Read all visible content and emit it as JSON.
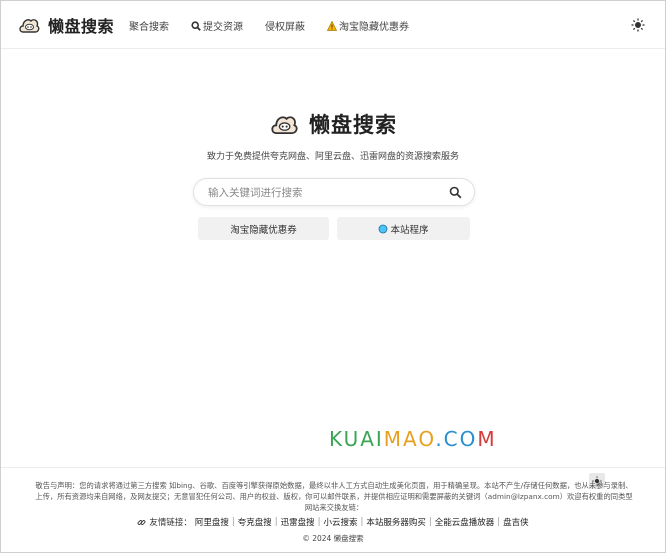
{
  "brand": {
    "name": "懒盘搜索",
    "icon": "cloud-face-icon"
  },
  "nav": {
    "items": [
      {
        "label": "聚合搜索",
        "icon": ""
      },
      {
        "label": "提交资源",
        "icon": "search-icon"
      },
      {
        "label": "侵权屏蔽",
        "icon": ""
      },
      {
        "label": "淘宝隐藏优惠券",
        "icon": "coupon-icon"
      }
    ]
  },
  "theme_toggle": {
    "icon": "sun-icon"
  },
  "hero": {
    "title": "懒盘搜索",
    "subtitle": "致力于免费提供夸克网盘、阿里云盘、迅雷网盘的资源搜索服务"
  },
  "search": {
    "placeholder": "输入关键词进行搜索",
    "value": ""
  },
  "buttons": {
    "coupon": "淘宝隐藏优惠券",
    "mini_program": "本站程序"
  },
  "watermark": {
    "text": "KUAIMAO.COM",
    "colors": [
      "#3aa655",
      "#e8a020",
      "#2a8fd0",
      "#d63a3a"
    ]
  },
  "footer": {
    "disclaimer_line1": "敬告与声明：您的请求将通过第三方搜索 如bing、谷歌、百度等引擎获得原始数据，最终以非人工方式自动生成美化页面，用于精确呈现。本站不产生/存储任何数据，也从未参与录制、",
    "disclaimer_line2": "上传，所有资源均来自网络，及网友提交；无意冒犯任何公司、用户的权益、版权，你可以邮件联系，并提供相应证明和需要屏蔽的关键词（admin@lzpanx.com）欢迎有权重的同类型",
    "disclaimer_line3": "网站来交换友链：",
    "links_label": "友情链接：",
    "links": [
      "阿里盘搜",
      "夸克盘搜",
      "迅雷盘搜",
      "小云搜索",
      "本站服务器购买",
      "全能云盘播放器",
      "盘吉侠"
    ],
    "copyright": "© 2024 懒盘搜索"
  }
}
